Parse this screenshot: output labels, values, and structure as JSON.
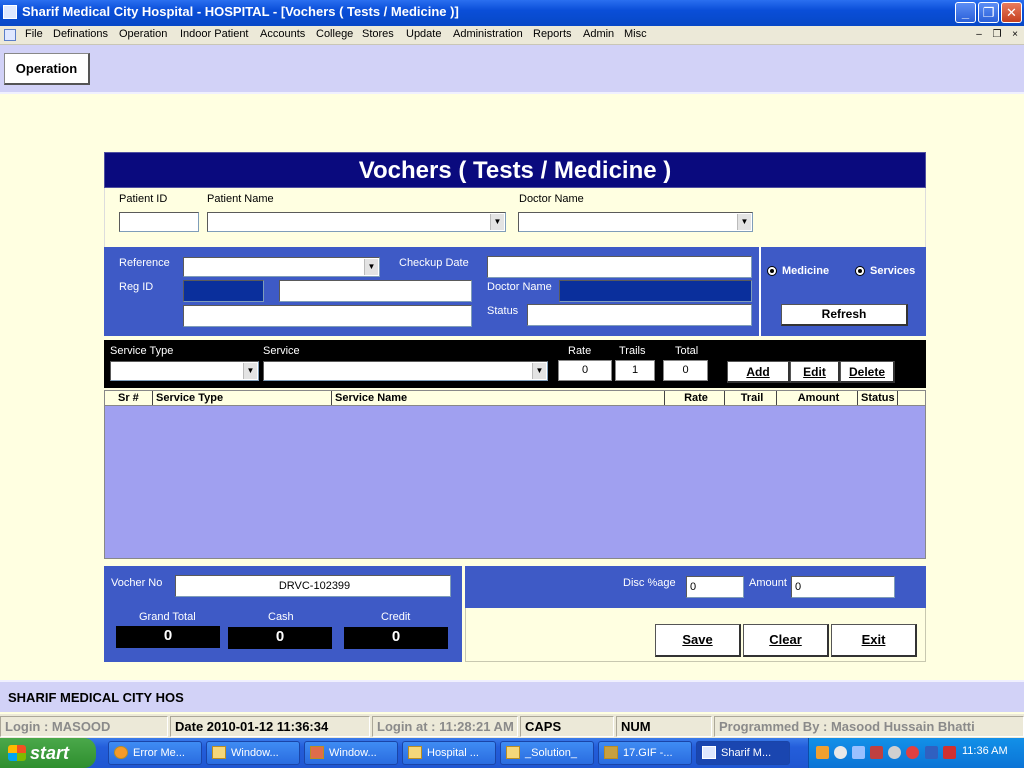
{
  "window": {
    "title": "Sharif Medical City Hospital - HOSPITAL - [Vochers ( Tests / Medicine )]",
    "min_label": "_",
    "max_label": "❐",
    "close_label": "✕"
  },
  "menu": {
    "items": [
      "File",
      "Definations",
      "Operation",
      "Indoor Patient",
      "Accounts",
      "College",
      "Stores",
      "Update",
      "Administration",
      "Reports",
      "Admin",
      "Misc"
    ],
    "mdi_min": "–",
    "mdi_restore": "❐",
    "mdi_close": "×"
  },
  "toolbar": {
    "operation_label": "Operation"
  },
  "form": {
    "title": "Vochers ( Tests / Medicine )",
    "patient_id_label": "Patient ID",
    "patient_name_label": "Patient Name",
    "doctor_name_label": "Doctor Name",
    "reference_label": "Reference",
    "checkup_date_label": "Checkup Date",
    "reg_id_label": "Reg ID",
    "doctor_name2_label": "Doctor Name",
    "status_label": "Status",
    "medicine_label": "Medicine",
    "services_label": "Services",
    "refresh_label": "Refresh"
  },
  "service_bar": {
    "service_type_label": "Service Type",
    "service_label": "Service",
    "rate_label": "Rate",
    "trails_label": "Trails",
    "total_label": "Total",
    "rate_value": "0",
    "trails_value": "1",
    "total_value": "0",
    "add_label": "Add",
    "edit_label": "Edit",
    "delete_label": "Delete"
  },
  "grid": {
    "columns": [
      "Sr #",
      "Service Type",
      "Service Name",
      "Rate",
      "Trail",
      "Amount",
      "Status"
    ],
    "rows": []
  },
  "totals": {
    "vocher_no_label": "Vocher No",
    "vocher_no_value": "DRVC-102399",
    "grand_total_label": "Grand Total",
    "cash_label": "Cash",
    "credit_label": "Credit",
    "grand_total_value": "0",
    "cash_value": "0",
    "credit_value": "0",
    "disc_label": "Disc  %age",
    "disc_value": "0",
    "amount_label": "Amount",
    "amount_value": "0"
  },
  "actions": {
    "save_label": "Save",
    "clear_label": "Clear",
    "exit_label": "Exit"
  },
  "company": {
    "name": "SHARIF MEDICAL CITY HOS"
  },
  "status": {
    "login": "Login :  MASOOD",
    "date": "Date 2010-01-12 11:36:34",
    "login_at": "Login at : 11:28:21 AM",
    "caps": "CAPS",
    "num": "NUM",
    "programmed_by": "Programmed By : Masood Hussain Bhatti"
  },
  "taskbar": {
    "start_label": "start",
    "tasks": [
      "Error Me...",
      "Window...",
      "Window...",
      "Hospital ...",
      "_Solution_",
      "17.GIF -...",
      "Sharif M..."
    ],
    "clock": "11:36 AM"
  }
}
